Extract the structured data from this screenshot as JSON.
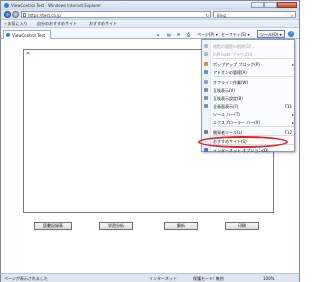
{
  "window": {
    "title": "ViewControl Test - Windows Internet Explorer"
  },
  "address_bar": {
    "url": "https://test.co.jp",
    "search_label": "Bing"
  },
  "favorites_bar": {
    "favorites_label": "お気に入り",
    "items": [
      "自分のおすすめサイト",
      "おすすめサイト"
    ]
  },
  "tab": {
    "label": "ViewControl Test"
  },
  "command_bar": {
    "page_label": "ページ(P) ▾",
    "safety_label": "セーフティ(S) ▾",
    "tools_label": "ツール(O) ▾",
    "help_label": "?"
  },
  "tools_menu": {
    "items": [
      {
        "label": "閲覧の履歴の削除(D)...",
        "shortcut": "",
        "disabled": true,
        "icon": "history-icon",
        "color": "#b0b8c4"
      },
      {
        "label": "InPrivate ブラウズ(I)",
        "shortcut": "",
        "disabled": true,
        "icon": "inprivate-icon",
        "color": "#b0b8c4"
      },
      {
        "label": "ポップアップ ブロック(P)",
        "shortcut": "",
        "disabled": false,
        "arrow": true,
        "icon": "popup-block-icon",
        "color": "#c89a2a"
      },
      {
        "label": "アドオンの管理(A)",
        "shortcut": "",
        "disabled": false,
        "icon": "addon-icon",
        "color": "#6a8cc2"
      },
      {
        "label": "オフライン作業(W)",
        "shortcut": "",
        "disabled": false,
        "icon": "offline-icon",
        "color": "#8aa6cc"
      },
      {
        "label": "互換表示(V)",
        "shortcut": "",
        "disabled": false,
        "icon": "compat-icon",
        "color": "#7b94b8"
      },
      {
        "label": "互換表示設定(B)",
        "shortcut": "",
        "disabled": false,
        "icon": "compat-settings-icon",
        "color": "#7b94b8"
      },
      {
        "label": "全画面表示(F)",
        "shortcut": "F11",
        "disabled": false,
        "icon": "fullscreen-icon",
        "color": "#6a8cc2"
      },
      {
        "label": "ツール バー(T)",
        "shortcut": "",
        "disabled": false,
        "arrow": true,
        "icon": "",
        "color": ""
      },
      {
        "label": "エクスプローラー バー(X)",
        "shortcut": "",
        "disabled": false,
        "arrow": true,
        "icon": "",
        "color": ""
      },
      {
        "label": "開発者ツール(L)",
        "shortcut": "F12",
        "disabled": false,
        "icon": "devtools-icon",
        "color": "#5a7fb0"
      },
      {
        "label": "おすすめサイト(S)",
        "shortcut": "",
        "disabled": false,
        "icon": "",
        "color": ""
      },
      {
        "label": "インターネット オプション(O)",
        "shortcut": "",
        "disabled": false,
        "icon": "options-icon",
        "color": "#4a78c0"
      }
    ]
  },
  "page": {
    "buttons": [
      "読書記録表",
      "学習分析",
      "解析",
      "印刷"
    ]
  },
  "status_bar": {
    "status": "ページが表示されました",
    "zone": "インターネット",
    "protected_mode": "保護モード: 無効",
    "zoom": "100%"
  },
  "colors": {
    "highlight": "#dd2222",
    "chrome": "#dfe6ef",
    "accent": "#3a7bd5"
  }
}
